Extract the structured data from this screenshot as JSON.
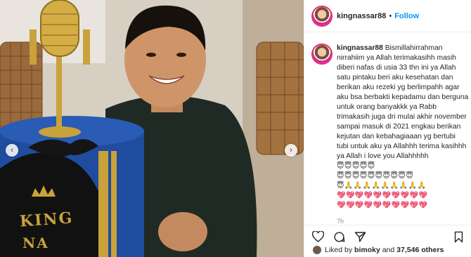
{
  "post": {
    "username": "kingnassar88",
    "follow_label": "Follow",
    "separator": "•",
    "caption_user": "kingnassar88",
    "caption_text": "Bismillahirrahman nirrahiim ya Allah terimakasihh masih diberi nafas di usia 33 thn ini ya Allah satu pintaku beri aku kesehatan dan berikan aku rezeki yg berlimpahh agar aku bsa berbakti kepadamu dan berguna untuk orang banyakkk ya Rabb trimakasih juga dri mulai akhir november sampai masuk di 2021 engkau berikan kejutan dan kebahagiaaan yg bertubi tubi untuk aku ya Allahhh terima kasihhh ya Allah i love you Allahhhhh",
    "emoji_lines": [
      "😇😇😇😇😇",
      "😇😇😇😇😇😇😇😇😇😇",
      "😇🙏🙏🙏🙏🙏🙏🙏🙏🙏",
      "💖💖💖💖💖💖💖💖💖💖",
      "💖💖💖💖💖💖💖💖💖💖"
    ],
    "time_ago": "7h",
    "liked_prefix": "Liked by",
    "liked_user": "bimoky",
    "liked_and": "and",
    "liked_count": "37,546 others"
  },
  "photo": {
    "cake_text_1": "KING",
    "cake_text_2": "NA"
  },
  "icons": {
    "prev": "chevron-left-icon",
    "next": "chevron-right-icon",
    "like": "heart-icon",
    "comment": "comment-icon",
    "share": "share-icon",
    "save": "bookmark-icon"
  },
  "colors": {
    "accent": "#0095f6",
    "cake_blue": "#1f4c9e",
    "gold": "#c9a23a",
    "text": "#262626",
    "muted": "#8e8e8e"
  }
}
